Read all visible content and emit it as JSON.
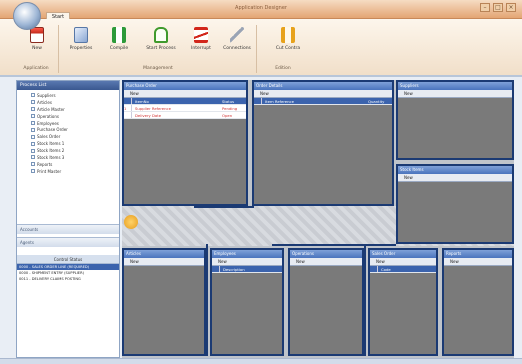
{
  "window": {
    "title": "Application Designer",
    "tab": "Start",
    "controls": [
      "–",
      "□",
      "×"
    ]
  },
  "ribbon": {
    "buttons": [
      {
        "label": "New"
      },
      {
        "label": "Properties"
      },
      {
        "label": "Compile"
      },
      {
        "label": "Start Process"
      },
      {
        "label": "Interrupt"
      },
      {
        "label": "Connections"
      },
      {
        "label": "Cut Contra"
      }
    ],
    "groups": [
      "Application",
      "Management",
      "Edition"
    ]
  },
  "leftpane": {
    "header": "Process List",
    "items": [
      "Suppliers",
      "Articles",
      "Article Master",
      "Operations",
      "Employees",
      "Purchase Order",
      "Sales Order",
      "Stock Items 1",
      "Stock Items 2",
      "Stock Items 3",
      "Reports",
      "Print Master"
    ],
    "sections": [
      "Accounts",
      "Agents"
    ],
    "bottom_header": "Control Status",
    "bottom_rows": [
      "0000 - SALES ORDER LINE (REQUIRED)",
      "0000 - SHIPMENT ENTRY (SUPPLIER)",
      "0011 - DELIVERY CLAIMS POSTING"
    ]
  },
  "panels": [
    {
      "title": "Purchase Order",
      "tool": "New",
      "rows": [
        {
          "c1": "",
          "c2": "ItemNo",
          "c3": "Status",
          "kind": "hdr"
        },
        {
          "c1": "1",
          "c2": "Supplier Reference",
          "c3": "Pending",
          "kind": "red"
        },
        {
          "c1": "",
          "c2": "Delivery Date",
          "c3": "Open",
          "kind": "red"
        }
      ]
    },
    {
      "title": "Order Details",
      "tool": "New",
      "rows": [
        {
          "c1": "",
          "c2": "Item Reference",
          "c3": "Quantity",
          "kind": "hdr"
        }
      ]
    },
    {
      "title": "Suppliers",
      "tool": "New",
      "rows": []
    },
    {
      "title": "Stock Items",
      "tool": "New",
      "rows": []
    },
    {
      "title": "Articles",
      "tool": "New",
      "rows": []
    },
    {
      "title": "Employees",
      "tool": "New",
      "rows": [
        {
          "c1": "",
          "c2": "Description",
          "c3": "",
          "kind": "hdr"
        }
      ]
    },
    {
      "title": "Operations",
      "tool": "New",
      "rows": []
    },
    {
      "title": "Sales Order",
      "tool": "New",
      "rows": [
        {
          "c1": "",
          "c2": "Code",
          "c3": "",
          "kind": "hdr"
        }
      ]
    },
    {
      "title": "Reports",
      "tool": "New",
      "rows": []
    }
  ],
  "colors": {
    "accent": "#3b63ad",
    "border": "#1b3a73",
    "ribbon": "#f1dfc9"
  }
}
